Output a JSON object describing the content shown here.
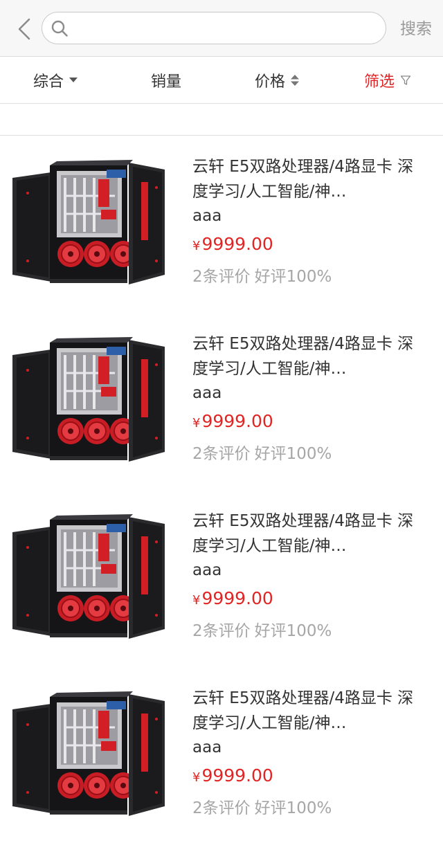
{
  "header": {
    "search_placeholder": "",
    "search_label": "搜索"
  },
  "filters": [
    {
      "label": "综合",
      "icon": "caret-down-icon",
      "active": false
    },
    {
      "label": "销量",
      "icon": "",
      "active": false
    },
    {
      "label": "价格",
      "icon": "sort-updown-icon",
      "active": false
    },
    {
      "label": "筛选",
      "icon": "filter-funnel-icon",
      "active": true
    }
  ],
  "colors": {
    "accent": "#e12524",
    "muted": "#a6a6a6",
    "text": "#333333"
  },
  "products": [
    {
      "title": "云轩 E5双路处理器/4路显卡 深度学习/人工智能/神…",
      "subtitle": "aaa",
      "currency": "¥",
      "price": "9999.00",
      "reviews": "2条评价",
      "rating": "好评100%"
    },
    {
      "title": "云轩 E5双路处理器/4路显卡 深度学习/人工智能/神…",
      "subtitle": "aaa",
      "currency": "¥",
      "price": "9999.00",
      "reviews": "2条评价",
      "rating": "好评100%"
    },
    {
      "title": "云轩 E5双路处理器/4路显卡 深度学习/人工智能/神…",
      "subtitle": "aaa",
      "currency": "¥",
      "price": "9999.00",
      "reviews": "2条评价",
      "rating": "好评100%"
    },
    {
      "title": "云轩 E5双路处理器/4路显卡 深度学习/人工智能/神…",
      "subtitle": "aaa",
      "currency": "¥",
      "price": "9999.00",
      "reviews": "2条评价",
      "rating": "好评100%"
    }
  ]
}
